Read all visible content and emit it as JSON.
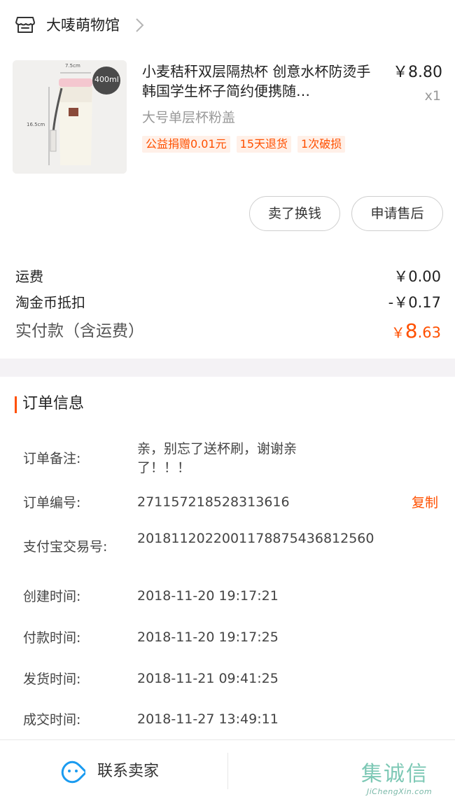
{
  "shop": {
    "name": "大唛萌物馆",
    "icon": "store-icon"
  },
  "product": {
    "title": "小麦秸秆双层隔热杯 创意水杯防烫手韩国学生杯子简约便携随…",
    "price": "￥8.80",
    "qty": "x1",
    "sku": "大号单层杯粉盖",
    "image": {
      "badge": "400ml",
      "width_label": "7.5cm",
      "height_label": "16.5cm"
    },
    "tags": [
      "公益捐赠0.01元",
      "15天退货",
      "1次破损"
    ]
  },
  "actions": {
    "sell": "卖了换钱",
    "after_sale": "申请售后"
  },
  "fees": {
    "shipping_label": "运费",
    "shipping_value": "￥0.00",
    "coin_label": "淘金币抵扣",
    "coin_value": "-￥0.17",
    "total_label": "实付款（含运费）",
    "total_currency": "￥",
    "total_int": "8",
    "total_dec": ".63"
  },
  "order_info": {
    "title": "订单信息",
    "remark_label": "订单备注:",
    "remark_value": "亲，别忘了送杯刷，谢谢亲了！！！",
    "order_no_label": "订单编号:",
    "order_no_value": "271157218528313616",
    "copy_label": "复制",
    "alipay_label": "支付宝交易号:",
    "alipay_value": "2018112022001178875436812560",
    "created_label": "创建时间:",
    "created_value": "2018-11-20 19:17:21",
    "paid_label": "付款时间:",
    "paid_value": "2018-11-20 19:17:25",
    "shipped_label": "发货时间:",
    "shipped_value": "2018-11-21 09:41:25",
    "closed_label": "成交时间:",
    "closed_value": "2018-11-27 13:49:11"
  },
  "bottom": {
    "contact_label": "联系卖家",
    "contact_icon": "chat-bubble-icon"
  },
  "watermark": {
    "chars": "集诚信",
    "url": "JiChengXin.com"
  },
  "colors": {
    "accent": "#ff5000",
    "tag_bg": "#fff0e8",
    "band": "#f4f2f5",
    "chat_icon": "#1a9bf0"
  }
}
